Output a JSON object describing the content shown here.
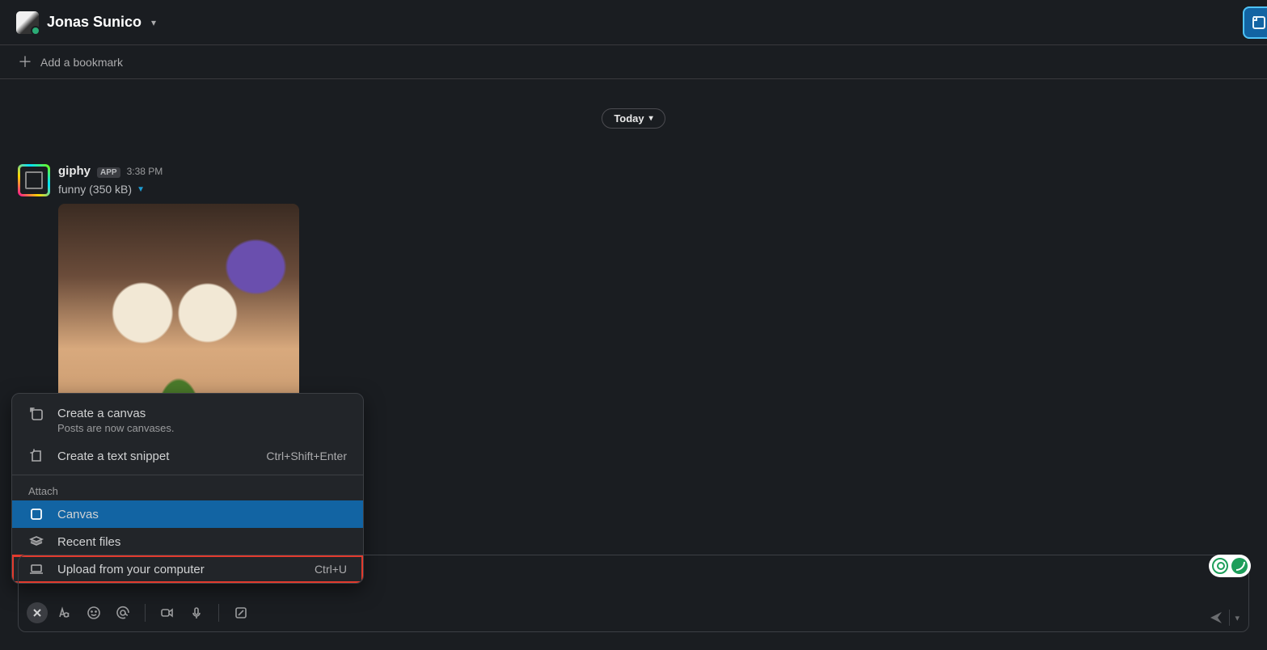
{
  "header": {
    "user_name": "Jonas Sunico"
  },
  "bookmark": {
    "add_label": "Add a bookmark"
  },
  "divider": {
    "date_label": "Today"
  },
  "message": {
    "sender": "giphy",
    "app_badge": "APP",
    "time": "3:38 PM",
    "file_label": "funny (350 kB)"
  },
  "menu": {
    "create_canvas": {
      "title": "Create a canvas",
      "sub": "Posts are now canvases."
    },
    "text_snippet": {
      "title": "Create a text snippet",
      "shortcut": "Ctrl+Shift+Enter"
    },
    "attach_label": "Attach",
    "canvas": {
      "title": "Canvas"
    },
    "recent_files": {
      "title": "Recent files"
    },
    "upload": {
      "title": "Upload from your computer",
      "shortcut": "Ctrl+U"
    }
  }
}
